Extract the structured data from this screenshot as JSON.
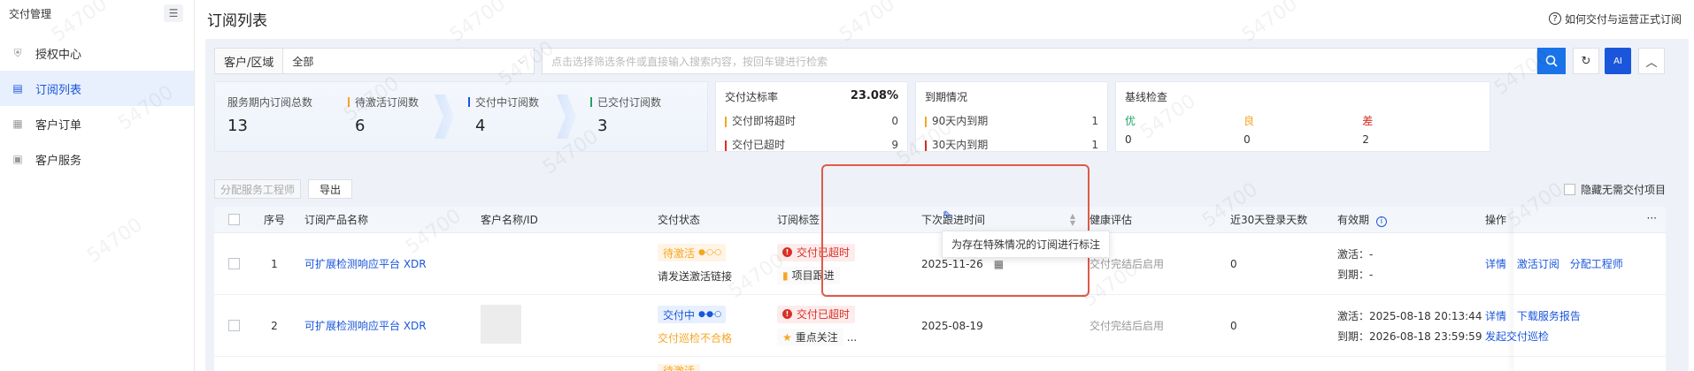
{
  "sidebar": {
    "title": "交付管理",
    "items": [
      {
        "label": "授权中心"
      },
      {
        "label": "订阅列表"
      },
      {
        "label": "客户订单"
      },
      {
        "label": "客户服务"
      }
    ]
  },
  "header": {
    "title": "订阅列表",
    "help_link": "如何交付与运营正式订阅"
  },
  "filter": {
    "region_label": "客户/区域",
    "region_value": "全部",
    "search_placeholder": "点击选择筛选条件或直接输入搜索内容，按回车键进行检索",
    "ai_label": "AI"
  },
  "stats": {
    "total": {
      "label": "服务期内订阅总数",
      "value": "13"
    },
    "pending": {
      "label": "待激活订阅数",
      "value": "6"
    },
    "delivering": {
      "label": "交付中订阅数",
      "value": "4"
    },
    "delivered": {
      "label": "已交付订阅数",
      "value": "3"
    }
  },
  "delivery_rate": {
    "title": "交付达标率",
    "value": "23.08%",
    "rows": [
      {
        "label": "交付即将超时",
        "value": "0"
      },
      {
        "label": "交付已超时",
        "value": "9"
      }
    ]
  },
  "expiry": {
    "title": "到期情况",
    "rows": [
      {
        "label": "90天内到期",
        "value": "1"
      },
      {
        "label": "30天内到期",
        "value": "1"
      }
    ]
  },
  "baseline": {
    "title": "基线检查",
    "grades": [
      {
        "label": "优",
        "value": "0"
      },
      {
        "label": "良",
        "value": "0"
      },
      {
        "label": "差",
        "value": "2"
      }
    ]
  },
  "actions": {
    "assign_label": "分配服务工程师",
    "export_label": "导出",
    "hide_label": "隐藏无需交付项目"
  },
  "table": {
    "headers": {
      "idx": "序号",
      "name": "订阅产品名称",
      "customer": "客户名称/ID",
      "status": "交付状态",
      "tag": "订阅标签",
      "next": "下次跟进时间",
      "health": "健康评估",
      "login": "近30天登录天数",
      "valid": "有效期",
      "ops": "操作",
      "more": "···"
    },
    "rows": [
      {
        "idx": "1",
        "name": "可扩展检测响应平台 XDR",
        "status": "待激活",
        "status_sub": "请发送激活链接",
        "tag_alert": "交付已超时",
        "tag_extra": "项目跟进",
        "next": "2025-11-26",
        "health": "交付完结后启用",
        "login": "0",
        "valid_active": "激活：-",
        "valid_expire": "到期：-",
        "ops": [
          "详情",
          "激活订阅",
          "分配工程师"
        ]
      },
      {
        "idx": "2",
        "name": "可扩展检测响应平台 XDR",
        "status": "交付中",
        "status_sub": "交付巡检不合格",
        "tag_alert": "交付已超时",
        "tag_extra": "重点关注",
        "tag_more": "...",
        "next": "2025-08-19",
        "health": "交付完结后启用",
        "login": "0",
        "valid_active": "激活：2025-08-18 20:13:44",
        "valid_expire": "到期：2026-08-18 23:59:59",
        "ops": [
          "详情",
          "下载服务报告",
          "发起交付巡检"
        ]
      },
      {
        "status": "待激活"
      }
    ]
  },
  "tooltip": "为存在特殊情况的订阅进行标注",
  "watermark": "54700",
  "colors": {
    "primary": "#1a56db",
    "danger": "#d93025",
    "warning": "#f5a623",
    "success": "#21a366"
  }
}
